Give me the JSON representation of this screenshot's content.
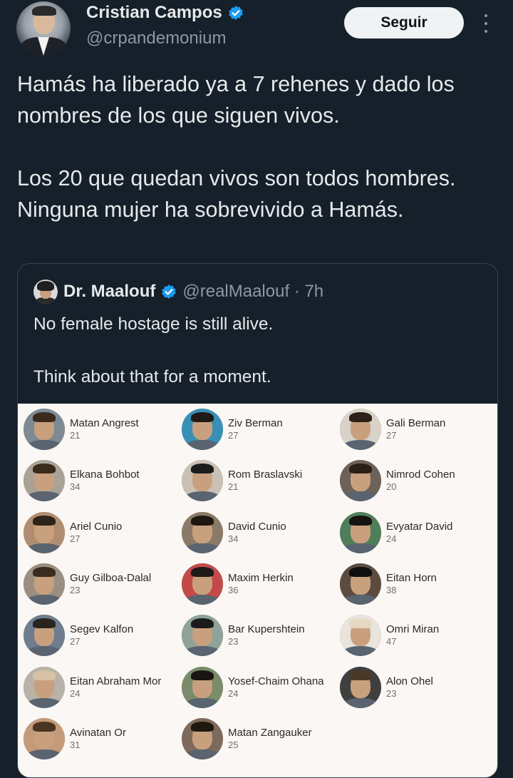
{
  "author": {
    "name": "Cristian Campos",
    "handle": "@crpandemonium",
    "follow_label": "Seguir",
    "verified_color": "#1d9bf0"
  },
  "tweet": {
    "text": "Hamás ha liberado ya a 7 rehenes y dado los nombres de los que siguen vivos.\n\nLos 20 que quedan vivos son todos hombres. Ninguna mujer ha sobrevivido a Hamás."
  },
  "quote": {
    "name": "Dr. Maalouf",
    "meta": "@realMaalouf · 7h",
    "text": "No female hostage is still alive.\n\nThink about that for a moment."
  },
  "hostages": [
    {
      "name": "Matan Angrest",
      "age": "21"
    },
    {
      "name": "Ziv Berman",
      "age": "27"
    },
    {
      "name": "Gali Berman",
      "age": "27"
    },
    {
      "name": "Elkana Bohbot",
      "age": "34"
    },
    {
      "name": "Rom Braslavski",
      "age": "21"
    },
    {
      "name": "Nimrod Cohen",
      "age": "20"
    },
    {
      "name": "Ariel Cunio",
      "age": "27"
    },
    {
      "name": "David Cunio",
      "age": "34"
    },
    {
      "name": "Evyatar David",
      "age": "24"
    },
    {
      "name": "Guy Gilboa-Dalal",
      "age": "23"
    },
    {
      "name": "Maxim Herkin",
      "age": "36"
    },
    {
      "name": "Eitan Horn",
      "age": "38"
    },
    {
      "name": "Segev Kalfon",
      "age": "27"
    },
    {
      "name": "Bar Kupershtein",
      "age": "23"
    },
    {
      "name": "Omri Miran",
      "age": "47"
    },
    {
      "name": "Eitan Abraham Mor",
      "age": "24"
    },
    {
      "name": "Yosef-Chaim Ohana",
      "age": "24"
    },
    {
      "name": "Alon Ohel",
      "age": "23"
    },
    {
      "name": "Avinatan Or",
      "age": "31"
    },
    {
      "name": "Matan Zangauker",
      "age": "25"
    }
  ]
}
